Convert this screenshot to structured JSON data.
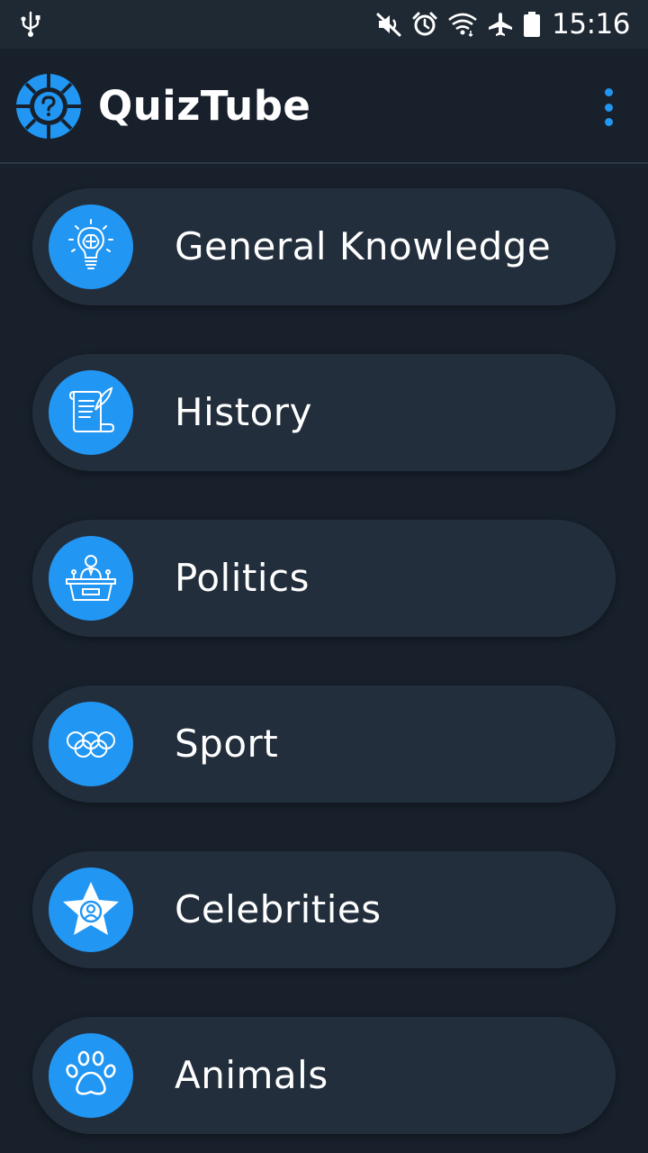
{
  "status_bar": {
    "time": "15:16",
    "icons": [
      "usb-icon",
      "mute-icon",
      "alarm-icon",
      "wifi-icon",
      "airplane-icon",
      "battery-icon"
    ]
  },
  "app_bar": {
    "title": "QuizTube",
    "logo": "quiztube-logo-icon",
    "menu_icon": "overflow-menu-icon"
  },
  "categories": [
    {
      "label": "General Knowledge",
      "icon": "lightbulb-brain-icon"
    },
    {
      "label": "History",
      "icon": "scroll-quill-icon"
    },
    {
      "label": "Politics",
      "icon": "podium-speaker-icon"
    },
    {
      "label": "Sport",
      "icon": "olympic-rings-icon"
    },
    {
      "label": "Celebrities",
      "icon": "star-person-icon"
    },
    {
      "label": "Animals",
      "icon": "paw-icon"
    }
  ],
  "colors": {
    "background": "#17202b",
    "status_bar": "#1f2934",
    "card": "#222e3c",
    "accent": "#2196f3",
    "text": "#ffffff"
  }
}
